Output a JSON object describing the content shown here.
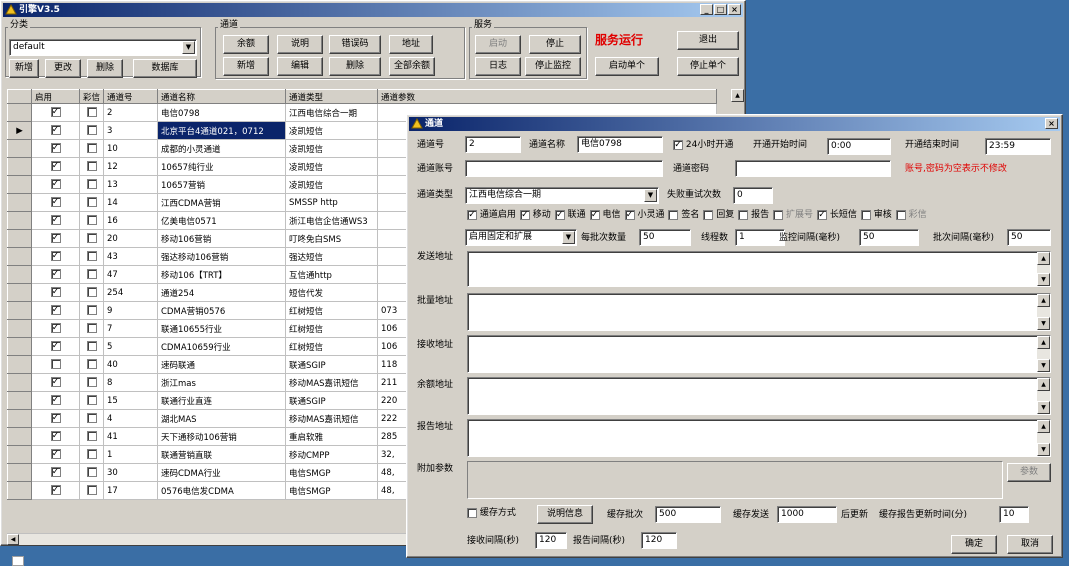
{
  "main": {
    "title": "引擎V3.5",
    "category_group": "分类",
    "category_value": "default",
    "cat_buttons": [
      "新增",
      "更改",
      "删除",
      "数据库"
    ],
    "channel_group": "通道",
    "channel_buttons_row1": [
      "余额",
      "说明",
      "错误码",
      "地址"
    ],
    "channel_buttons_row2": [
      "新增",
      "编辑",
      "删除",
      "全部余额"
    ],
    "service_group": "服务",
    "service_buttons_row1": [
      "启动",
      "停止"
    ],
    "service_buttons_row2": [
      "日志",
      "停止监控",
      "启动单个"
    ],
    "service_status": "服务运行",
    "exit_button": "退出",
    "stop_single_button": "停止单个",
    "columns": [
      "启用",
      "彩信",
      "通道号",
      "通道名称",
      "通道类型",
      "通道参数"
    ],
    "rows": [
      {
        "en": true,
        "mms": false,
        "no": "2",
        "name": "电信0798",
        "type": "江西电信综合一期",
        "param": ""
      },
      {
        "en": true,
        "mms": false,
        "no": "3",
        "name": "北京平台4通道021，0712",
        "type": "凌凯短信",
        "param": "",
        "selected": true
      },
      {
        "en": true,
        "mms": false,
        "no": "10",
        "name": "成都的小灵通道",
        "type": "凌凯短信",
        "param": ""
      },
      {
        "en": true,
        "mms": false,
        "no": "12",
        "name": "10657纯行业",
        "type": "凌凯短信",
        "param": ""
      },
      {
        "en": true,
        "mms": false,
        "no": "13",
        "name": "10657营销",
        "type": "凌凯短信",
        "param": ""
      },
      {
        "en": true,
        "mms": false,
        "no": "14",
        "name": "江西CDMA营销",
        "type": "SMSSP http",
        "param": ""
      },
      {
        "en": true,
        "mms": false,
        "no": "16",
        "name": "亿美电信0571",
        "type": "浙江电信企信通WS3",
        "param": ""
      },
      {
        "en": true,
        "mms": false,
        "no": "20",
        "name": "移动106营销",
        "type": "叮咚免白SMS",
        "param": ""
      },
      {
        "en": true,
        "mms": false,
        "no": "43",
        "name": "强达移动106营销",
        "type": "强达短信",
        "param": ""
      },
      {
        "en": true,
        "mms": false,
        "no": "47",
        "name": "移动106【TRT】",
        "type": "互信通http",
        "param": ""
      },
      {
        "en": true,
        "mms": false,
        "no": "254",
        "name": "通道254",
        "type": "短信代发",
        "param": ""
      },
      {
        "en": true,
        "mms": false,
        "no": "9",
        "name": "CDMA营销0576",
        "type": "红树短信",
        "param": "073"
      },
      {
        "en": true,
        "mms": false,
        "no": "7",
        "name": "联通10655行业",
        "type": "红树短信",
        "param": "106"
      },
      {
        "en": true,
        "mms": false,
        "no": "5",
        "name": "CDMA10659行业",
        "type": "红树短信",
        "param": "106"
      },
      {
        "en": false,
        "mms": false,
        "no": "40",
        "name": "速码联通",
        "type": "联通SGIP",
        "param": "118"
      },
      {
        "en": true,
        "mms": false,
        "no": "8",
        "name": "浙江mas",
        "type": "移动MAS嘉讯短信",
        "param": "211"
      },
      {
        "en": true,
        "mms": false,
        "no": "15",
        "name": "联通行业直连",
        "type": "联通SGIP",
        "param": "220"
      },
      {
        "en": true,
        "mms": false,
        "no": "4",
        "name": "湖北MAS",
        "type": "移动MAS嘉讯短信",
        "param": "222"
      },
      {
        "en": true,
        "mms": false,
        "no": "41",
        "name": "天下通移动106营销",
        "type": "重启软雅",
        "param": "285"
      },
      {
        "en": true,
        "mms": false,
        "no": "1",
        "name": "联通营销直联",
        "type": "移动CMPP",
        "param": "32,"
      },
      {
        "en": true,
        "mms": false,
        "no": "30",
        "name": "速码CDMA行业",
        "type": "电信SMGP",
        "param": "48,"
      },
      {
        "en": true,
        "mms": false,
        "no": "17",
        "name": "0576电信发CDMA",
        "type": "电信SMGP",
        "param": "48,"
      }
    ]
  },
  "dialog": {
    "title": "通道",
    "channel_no_label": "通道号",
    "channel_no": "2",
    "channel_name_label": "通道名称",
    "channel_name": "电信0798",
    "open24_label": "24小时开通",
    "start_time_label": "开通开始时间",
    "start_time": "0:00",
    "end_time_label": "开通结束时间",
    "end_time": "23:59",
    "account_label": "通道账号",
    "password_label": "通道密码",
    "hint": "账号,密码为空表示不修改",
    "type_label": "通道类型",
    "type_value": "江西电信综合一期",
    "retry_label": "失败重试次数",
    "retry_value": "0",
    "flags": [
      {
        "label": "通道启用",
        "checked": true,
        "disabled": false
      },
      {
        "label": "移动",
        "checked": true,
        "disabled": false
      },
      {
        "label": "联通",
        "checked": true,
        "disabled": false
      },
      {
        "label": "电信",
        "checked": true,
        "disabled": false
      },
      {
        "label": "小灵通",
        "checked": true,
        "disabled": false
      },
      {
        "label": "签名",
        "checked": false,
        "disabled": false
      },
      {
        "label": "回复",
        "checked": false,
        "disabled": false
      },
      {
        "label": "报告",
        "checked": false,
        "disabled": false
      },
      {
        "label": "扩展号",
        "checked": false,
        "disabled": true
      },
      {
        "label": "长短信",
        "checked": true,
        "disabled": false
      },
      {
        "label": "审核",
        "checked": false,
        "disabled": false
      },
      {
        "label": "彩信",
        "checked": false,
        "disabled": true
      }
    ],
    "ext_mode": "启用固定和扩展",
    "batch_count_label": "每批次数量",
    "batch_count": "50",
    "threads_label": "线程数",
    "threads": "1",
    "monitor_label": "监控间隔(毫秒)",
    "monitor": "50",
    "batch_interval_label": "批次间隔(毫秒)",
    "batch_interval": "50",
    "send_url_label": "发送地址",
    "batch_url_label": "批量地址",
    "recv_url_label": "接收地址",
    "balance_url_label": "余额地址",
    "report_url_label": "报告地址",
    "extra_label": "附加参数",
    "param_button": "参数",
    "cache_mode_label": "缓存方式",
    "explain_button": "说明信息",
    "cache_batch_label": "缓存批次",
    "cache_batch": "500",
    "cache_send_label": "缓存发送",
    "cache_send": "1000",
    "after_update_label": "后更新",
    "cache_report_label": "缓存报告更新时间(分)",
    "cache_report": "10",
    "recv_interval_label": "接收间隔(秒)",
    "recv_interval": "120",
    "report_interval_label": "报告间隔(秒)",
    "report_interval": "120",
    "ok_button": "确定",
    "cancel_button": "取消"
  }
}
